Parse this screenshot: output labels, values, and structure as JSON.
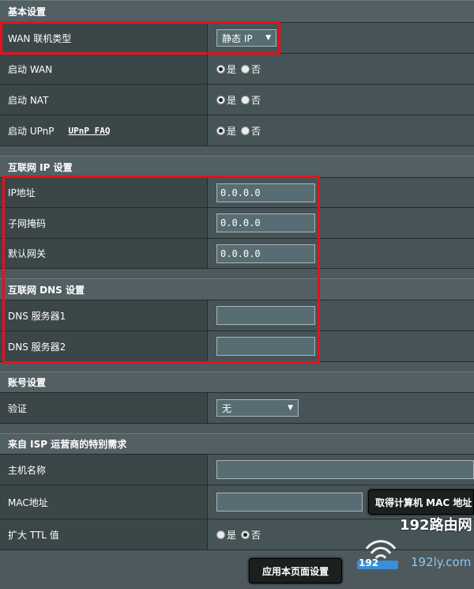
{
  "basic": {
    "title": "基本设置",
    "wan_type_label": "WAN 联机类型",
    "wan_type_value": "静态 IP",
    "enable_wan_label": "启动 WAN",
    "enable_nat_label": "启动 NAT",
    "enable_upnp_label": "启动 UPnP",
    "upnp_faq": "UPnP FAQ",
    "yes": "是",
    "no": "否"
  },
  "internet_ip": {
    "title": "互联网 IP 设置",
    "ip_label": "IP地址",
    "ip_value": "0.0.0.0",
    "mask_label": "子网掩码",
    "mask_value": "0.0.0.0",
    "gw_label": "默认网关",
    "gw_value": "0.0.0.0"
  },
  "dns": {
    "title": "互联网 DNS 设置",
    "dns1_label": "DNS 服务器1",
    "dns1_value": "",
    "dns2_label": "DNS 服务器2",
    "dns2_value": ""
  },
  "account": {
    "title": "账号设置",
    "auth_label": "验证",
    "auth_value": "无"
  },
  "isp": {
    "title": "来自 ISP 运营商的特别需求",
    "host_label": "主机名称",
    "host_value": "",
    "mac_label": "MAC地址",
    "mac_value": "",
    "mac_button": "取得计算机 MAC 地址",
    "ttl_label": "扩大 TTL 值"
  },
  "apply_button": "应用本页面设置",
  "watermark": {
    "text": "192路由网",
    "small_text": "192",
    "url": "192ly.com"
  },
  "colors": {
    "highlight": "#e8101c",
    "bg": "#4d595d"
  }
}
